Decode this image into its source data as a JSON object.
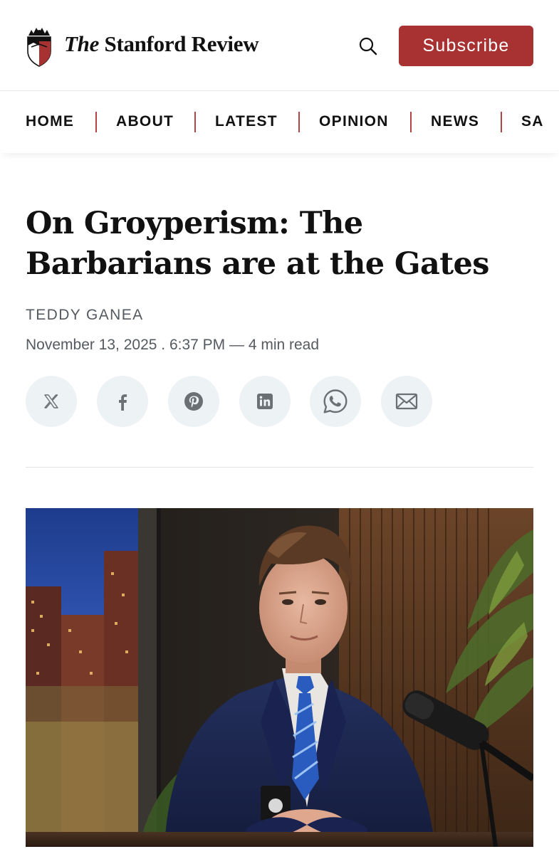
{
  "header": {
    "logo_prefix": "The",
    "logo_name": "Stanford Review",
    "search_label": "Search",
    "subscribe_label": "Subscribe",
    "brand_color": "#a83232"
  },
  "nav": {
    "items": [
      {
        "label": "HOME"
      },
      {
        "label": "ABOUT"
      },
      {
        "label": "LATEST"
      },
      {
        "label": "OPINION"
      },
      {
        "label": "NEWS"
      },
      {
        "label": "SA"
      }
    ]
  },
  "article": {
    "title_line1": "On Groyperism: The",
    "title_line2": "Barbarians are at the Gates",
    "author": "TEDDY GANEA",
    "date": "November 13, 2025",
    "time": "6:37 PM",
    "read_time": "4 min read",
    "meta_line": "November 13, 2025 . 6:37 PM — 4 min read"
  },
  "share": {
    "icons": [
      "x-icon",
      "facebook-icon",
      "pinterest-icon",
      "linkedin-icon",
      "whatsapp-icon",
      "email-icon"
    ]
  },
  "hero_image": {
    "description_icon": "article-hero-photo"
  }
}
